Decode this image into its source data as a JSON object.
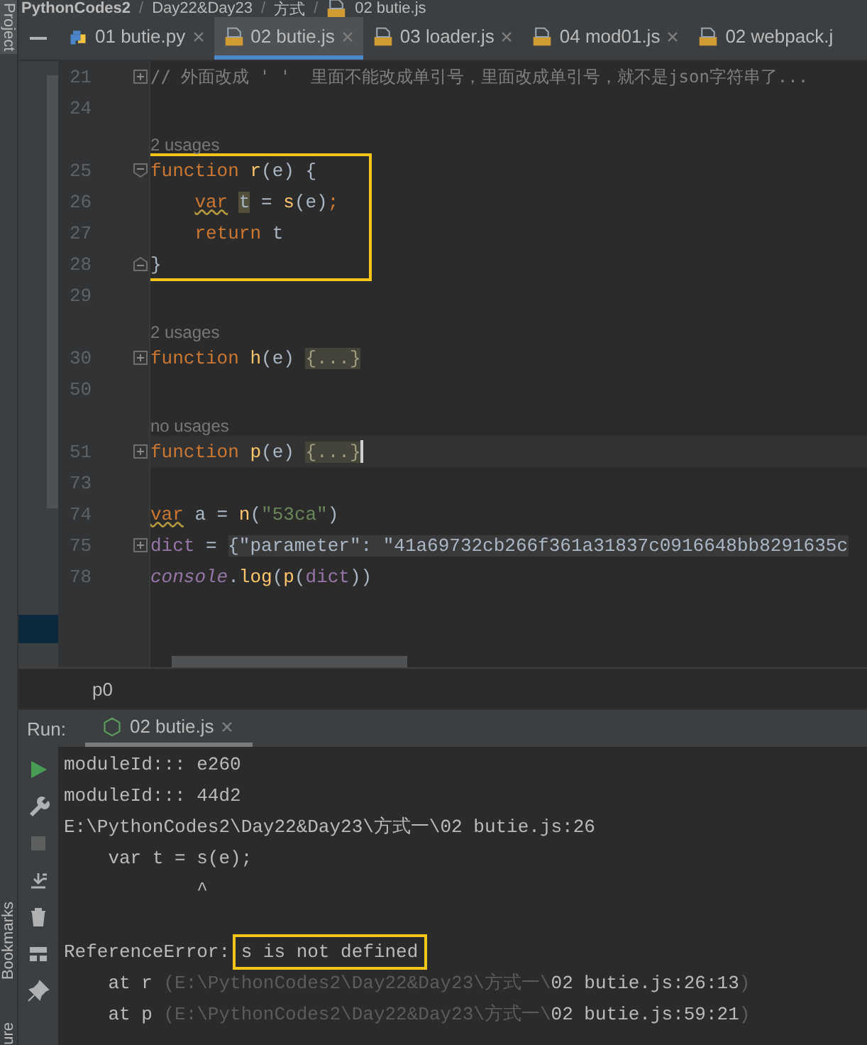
{
  "breadcrumbs": [
    {
      "label": "PythonCodes2",
      "kind": "root"
    },
    {
      "label": "/",
      "kind": "separator"
    },
    {
      "label": "Day22&Day23",
      "kind": "folder"
    },
    {
      "label": "/",
      "kind": "separator"
    },
    {
      "label": "方式",
      "kind": "folder"
    },
    {
      "label": "/",
      "kind": "separator"
    },
    {
      "label": "02 butie.js",
      "kind": "js"
    }
  ],
  "left_strip": {
    "top": [
      "Project"
    ],
    "bottom": [
      "Bookmarks",
      "ure"
    ]
  },
  "tabs": [
    {
      "label": "01 butie.py",
      "kind": "py",
      "selected": false
    },
    {
      "label": "02 butie.js",
      "kind": "js",
      "selected": true
    },
    {
      "label": "03 loader.js",
      "kind": "js",
      "selected": false
    },
    {
      "label": "04 mod01.js",
      "kind": "js",
      "selected": false
    },
    {
      "label": "02 webpack.j",
      "kind": "js",
      "selected": false
    }
  ],
  "editor": {
    "lines": [
      {
        "kind": "code",
        "number": "21",
        "fold": {
          "kind": "collapsed"
        },
        "current": false,
        "boxed": false,
        "indented": false,
        "tokens": [
          {
            "kind": "comment",
            "text": "// 外面改成 ' '  里面不能改成单引号，里面改成单引号，就不是json字符串了..."
          }
        ]
      },
      {
        "kind": "code",
        "number": "24",
        "current": false,
        "boxed": false
      },
      {
        "kind": "usages",
        "text": "2 usages"
      },
      {
        "kind": "code",
        "number": "25",
        "fold": {
          "kind": "open"
        },
        "current": false,
        "boxed": true,
        "indented": false,
        "tokens": [
          {
            "kind": "kw",
            "text": "function"
          },
          {
            "kind": "fn",
            "text": " r"
          },
          {
            "kind": "plain",
            "text": "(e) {"
          }
        ]
      },
      {
        "kind": "code",
        "number": "26",
        "current": false,
        "boxed": true,
        "indented": true,
        "tokens": [
          {
            "kind": "kw_warn",
            "text": "var"
          },
          {
            "kind": "highlight",
            "text": "t"
          },
          {
            "kind": "plain",
            "text": " = "
          },
          {
            "kind": "fn",
            "text": "s"
          },
          {
            "kind": "plain",
            "text": "(e)"
          },
          {
            "kind": "kw",
            "text": ";"
          }
        ]
      },
      {
        "kind": "code",
        "number": "27",
        "current": false,
        "boxed": true,
        "indented": true,
        "tokens": [
          {
            "kind": "kw",
            "text": "return"
          },
          {
            "kind": "plain",
            "text": " t"
          }
        ]
      },
      {
        "kind": "code",
        "number": "28",
        "fold": {
          "kind": "end"
        },
        "current": false,
        "boxed": true,
        "indented": false,
        "tokens": [
          {
            "kind": "plain",
            "text": "}"
          }
        ]
      },
      {
        "kind": "code",
        "number": "29",
        "current": false,
        "boxed": false
      },
      {
        "kind": "usages",
        "text": "2 usages"
      },
      {
        "kind": "code",
        "number": "30",
        "fold": {
          "kind": "collapsed"
        },
        "current": false,
        "boxed": false,
        "indented": false,
        "tokens": [
          {
            "kind": "kw",
            "text": "function"
          },
          {
            "kind": "fn",
            "text": " h"
          },
          {
            "kind": "plain",
            "text": "(e) "
          },
          {
            "kind": "folded",
            "text": "{...}"
          }
        ]
      },
      {
        "kind": "code",
        "number": "50",
        "current": false,
        "boxed": false
      },
      {
        "kind": "usages",
        "text": "no usages"
      },
      {
        "kind": "code",
        "number": "51",
        "fold": {
          "kind": "collapsed"
        },
        "current": true,
        "boxed": false,
        "indented": false,
        "tokens": [
          {
            "kind": "kw",
            "text": "function"
          },
          {
            "kind": "fn",
            "text": " p"
          },
          {
            "kind": "plain",
            "text": "(e) "
          },
          {
            "kind": "folded",
            "text": "{...}"
          }
        ]
      },
      {
        "kind": "code",
        "number": "73",
        "current": false,
        "boxed": false
      },
      {
        "kind": "code",
        "number": "74",
        "current": false,
        "boxed": false,
        "indented": false,
        "tokens": [
          {
            "kind": "kw_warn",
            "text": "var"
          },
          {
            "kind": "plain",
            "text": "a = "
          },
          {
            "kind": "fn",
            "text": "n"
          },
          {
            "kind": "plain",
            "text": "("
          },
          {
            "kind": "string",
            "text": "\"53ca\""
          },
          {
            "kind": "plain",
            "text": ")"
          }
        ]
      },
      {
        "kind": "code",
        "number": "75",
        "fold": {
          "kind": "collapsed"
        },
        "current": false,
        "boxed": false,
        "indented": false,
        "tokens": [
          {
            "kind": "var",
            "text": "dict"
          },
          {
            "kind": "plain",
            "text": " = "
          },
          {
            "kind": "inline_fold",
            "text": "{\"parameter\": \"41a69732cb266f361a31837c0916648bb8291635c"
          }
        ]
      },
      {
        "kind": "code",
        "number": "78",
        "current": false,
        "boxed": false,
        "indented": false,
        "tokens": [
          {
            "kind": "global",
            "text": "console"
          },
          {
            "kind": "plain",
            "text": "."
          },
          {
            "kind": "fn",
            "text": "log"
          },
          {
            "kind": "plain",
            "text": "("
          },
          {
            "kind": "fn",
            "text": "p"
          },
          {
            "kind": "plain",
            "text": "("
          },
          {
            "kind": "var",
            "text": "dict"
          },
          {
            "kind": "plain",
            "text": "))"
          }
        ]
      }
    ]
  },
  "breadcrumb": "p0",
  "run": {
    "label": "Run:",
    "tab": "02 butie.js",
    "console": [
      {
        "kind": "text",
        "tokens": [
          {
            "kind": "out",
            "text": "moduleId::: e260"
          }
        ]
      },
      {
        "kind": "text",
        "tokens": [
          {
            "kind": "out",
            "text": "moduleId::: 44d2"
          }
        ]
      },
      {
        "kind": "text",
        "tokens": [
          {
            "kind": "out",
            "text": "E:\\PythonCodes2\\Day22&Day23\\方式一\\02 butie.js:26"
          }
        ]
      },
      {
        "kind": "text",
        "tokens": [
          {
            "kind": "out",
            "text": "    var t = s(e);"
          }
        ]
      },
      {
        "kind": "text",
        "tokens": [
          {
            "kind": "out",
            "text": "            ^"
          }
        ]
      },
      {
        "kind": "blank"
      },
      {
        "kind": "text",
        "tokens": [
          {
            "kind": "out",
            "text": "ReferenceError: "
          },
          {
            "kind": "boxed",
            "text": "s is not defined"
          }
        ]
      },
      {
        "kind": "text",
        "tokens": [
          {
            "kind": "out",
            "text": "    at r "
          },
          {
            "kind": "dim",
            "text": "(E:\\PythonCodes2\\Day22&Day23\\方式一\\"
          },
          {
            "kind": "out",
            "text": "02 butie.js:26:13"
          },
          {
            "kind": "dim",
            "text": ")"
          }
        ]
      },
      {
        "kind": "text",
        "tokens": [
          {
            "kind": "out",
            "text": "    at p "
          },
          {
            "kind": "dim",
            "text": "(E:\\PythonCodes2\\Day22&Day23\\方式一\\"
          },
          {
            "kind": "out",
            "text": "02 butie.js:59:21"
          },
          {
            "kind": "dim",
            "text": ")"
          }
        ]
      }
    ]
  }
}
